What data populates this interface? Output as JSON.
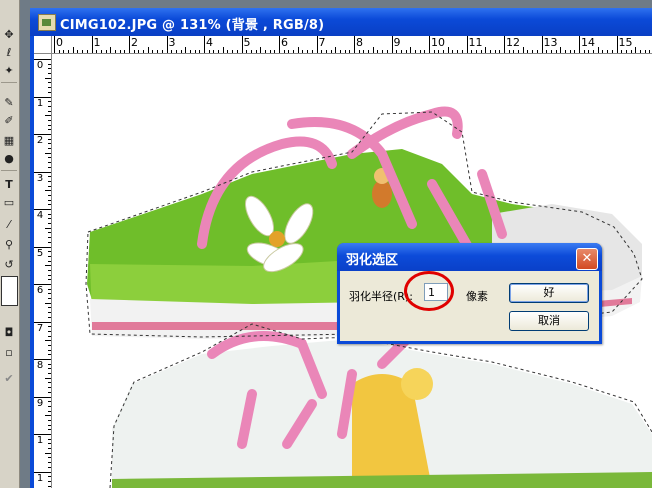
{
  "window": {
    "title": "CIMG102.JPG @ 131% (背景 , RGB/8)"
  },
  "ruler": {
    "horizontal": [
      "0",
      "1",
      "2",
      "3",
      "4",
      "5",
      "6",
      "7",
      "8",
      "9",
      "10",
      "11",
      "12",
      "13",
      "14",
      "15"
    ],
    "vertical": [
      "0",
      "1",
      "2",
      "3",
      "4",
      "5",
      "6",
      "7",
      "8",
      "9",
      "1",
      "1"
    ]
  },
  "dialog": {
    "title": "羽化选区",
    "close_icon": "close-icon",
    "radius_label": "羽化半径(R):",
    "radius_value": "1",
    "unit_label": "像素",
    "ok_label": "好",
    "cancel_label": "取消"
  },
  "toolbar": {
    "icons": [
      "move-icon",
      "lasso-icon",
      "magic-wand-icon",
      "brush-icon",
      "history-brush-icon",
      "gradient-icon",
      "burn-icon",
      "type-icon",
      "shape-icon",
      "eyedropper-icon",
      "zoom-icon",
      "swap-colors-icon",
      "color-swatch",
      "quick-mask-icon",
      "screen-mode-icon",
      "jump-icon"
    ]
  },
  "colors": {
    "titlebar": "#0a4ad8",
    "annotation": "#e00000"
  }
}
